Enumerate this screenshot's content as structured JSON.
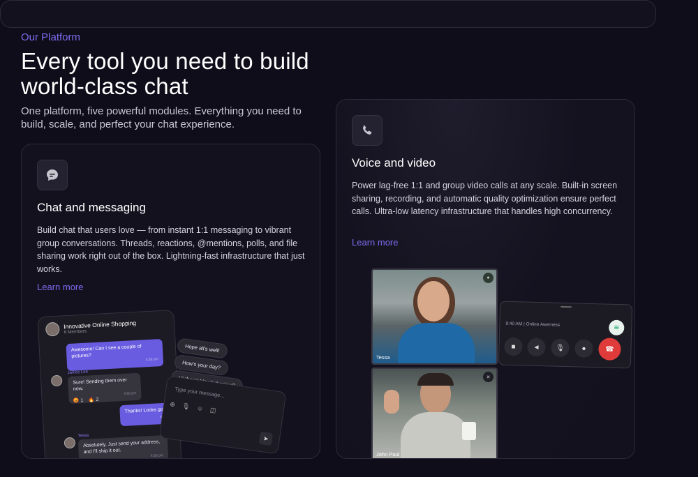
{
  "section": {
    "eyebrow": "Our Platform",
    "headline_1": "Every tool you need to build",
    "headline_2": "world-class chat",
    "subtitle": "One platform, five powerful modules. Everything you need to build, scale, and perfect your chat experience."
  },
  "chat_card": {
    "icon": "chat-bubble-icon",
    "title": "Chat and messaging",
    "description": "Build chat that users love — from instant 1:1 messaging to vibrant group conversations. Threads, reactions, @mentions, polls, and file sharing work right out of the box. Lightning-fast infrastructure that just works.",
    "link": "Learn more",
    "mock": {
      "channel": "Innovative Online Shopping",
      "members": "6 Members",
      "msg1": "Awesome! Can I see a couple of pictures?",
      "msg1_time": "4:56 pm",
      "sender2": "James Lee",
      "msg2": "Sure! Sending them over now.",
      "msg2_time": "4:56 pm",
      "react1": "😡 1",
      "react2": "🔥 2",
      "msg3": "Thanks! Looks good",
      "msg3_time": "4:56 pm",
      "sender4": "Tessa",
      "msg4": "Absolutely. Just send your address, and I'll ship it out.",
      "msg4_time": "4:56 pm",
      "suggestions": [
        "Hope all's well!",
        "How's your day?",
        "Hi there! How's it going?"
      ],
      "composer_placeholder": "Type your message..."
    }
  },
  "video_card": {
    "icon": "phone-icon",
    "title": "Voice and video",
    "description": "Power lag-free 1:1 and group video calls at any scale. Built-in screen sharing, recording, and automatic quality optimization ensure perfect calls. Ultra-low latency infrastructure that handles high concurrency.",
    "link": "Learn more",
    "mock": {
      "participant_1": "Tessa",
      "participant_2": "John Paul",
      "call_status": "9:40 AM | Online Awerness"
    }
  },
  "colors": {
    "background": "#0f0d19",
    "accent": "#7d6cf0",
    "end_call": "#e03b3b"
  }
}
